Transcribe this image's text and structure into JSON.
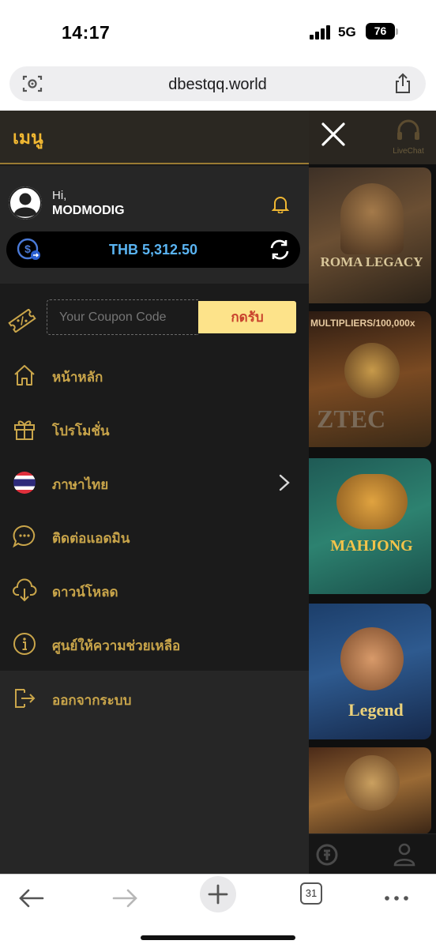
{
  "status_bar": {
    "time": "14:17",
    "network": "5G",
    "battery": "76"
  },
  "browser": {
    "url": "dbestqq.world",
    "tab_count": "31"
  },
  "menu": {
    "title": "เมนู",
    "greeting": "Hi,",
    "username": "MODMODIG",
    "balance": "THB 5,312.50",
    "coupon_placeholder": "Your Coupon Code",
    "coupon_button": "กดรับ",
    "items": [
      {
        "label": "หน้าหลัก",
        "icon": "home-icon"
      },
      {
        "label": "โปรโมชั่น",
        "icon": "gift-icon"
      },
      {
        "label": "ภาษาไทย",
        "icon": "thai-flag-icon"
      },
      {
        "label": "ติดต่อแอดมิน",
        "icon": "chat-icon"
      },
      {
        "label": "ดาวน์โหลด",
        "icon": "cloud-download-icon"
      },
      {
        "label": "ศูนย์ให้ความช่วยเหลือ",
        "icon": "info-icon"
      },
      {
        "label": "ออกจากระบบ",
        "icon": "logout-icon"
      }
    ]
  },
  "background": {
    "livechat_label": "LiveChat",
    "games": [
      {
        "title": "ROMA LEGACY"
      },
      {
        "title": "MULTIPLIERS/100,000x"
      },
      {
        "title": "MAHJONG"
      },
      {
        "title": "Legend"
      }
    ]
  },
  "colors": {
    "accent_gold": "#c9a54a",
    "menu_title": "#f0b732",
    "balance_blue": "#5ab4f2",
    "coupon_button_bg": "#fde38a"
  }
}
